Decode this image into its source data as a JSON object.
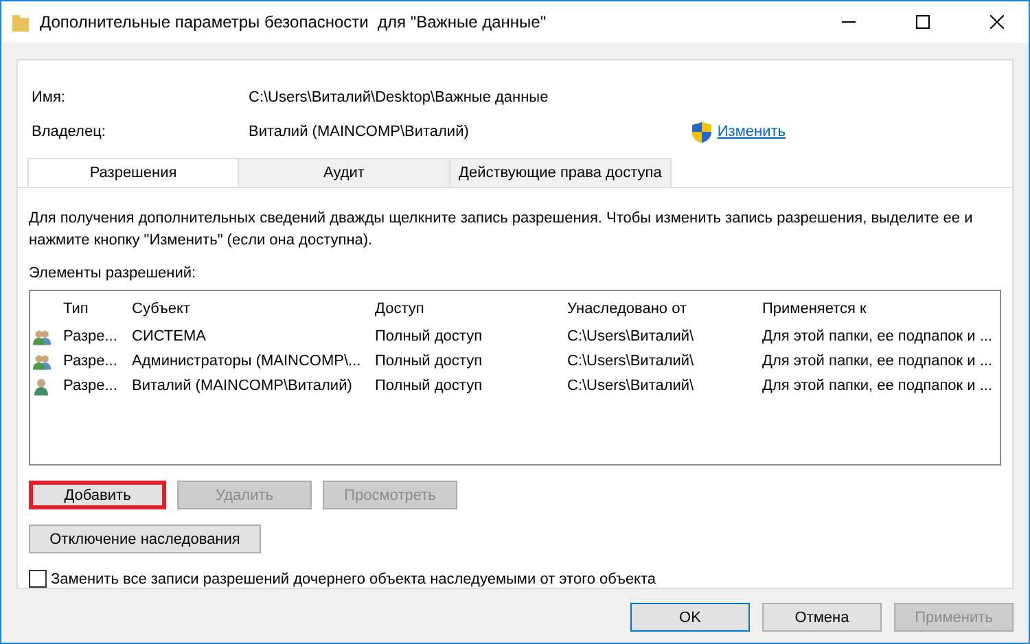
{
  "window": {
    "title": "Дополнительные параметры безопасности  для \"Важные данные\""
  },
  "name": {
    "label": "Имя:",
    "value": "C:\\Users\\Виталий\\Desktop\\Важные данные"
  },
  "owner": {
    "label": "Владелец:",
    "value": "Виталий (MAINCOMP\\Виталий)",
    "link": "Изменить"
  },
  "tabs": [
    {
      "label": "Разрешения",
      "selected": true
    },
    {
      "label": "Аудит",
      "selected": false
    },
    {
      "label": "Действующие права доступа",
      "selected": false
    }
  ],
  "description": "Для получения дополнительных сведений дважды щелкните запись разрешения. Чтобы изменить запись разрешения, выделите ее и нажмите кнопку \"Изменить\" (если она доступна).",
  "list_label": "Элементы разрешений:",
  "table": {
    "columns": [
      "Тип",
      "Субъект",
      "Доступ",
      "Унаследовано от",
      "Применяется к"
    ],
    "rows": [
      {
        "kind": "group",
        "cells": [
          "Разре...",
          "СИСТЕМА",
          "Полный доступ",
          "C:\\Users\\Виталий\\",
          "Для этой папки, ее подпапок и ..."
        ]
      },
      {
        "kind": "group",
        "cells": [
          "Разре...",
          "Администраторы (MAINCOMP\\...",
          "Полный доступ",
          "C:\\Users\\Виталий\\",
          "Для этой папки, ее подпапок и ..."
        ]
      },
      {
        "kind": "user",
        "cells": [
          "Разре...",
          "Виталий (MAINCOMP\\Виталий)",
          "Полный доступ",
          "C:\\Users\\Виталий\\",
          "Для этой папки, ее подпапок и ..."
        ]
      }
    ]
  },
  "entry_buttons": [
    {
      "label": "Добавить",
      "disabled": false,
      "highlighted": true
    },
    {
      "label": "Удалить",
      "disabled": true,
      "highlighted": false
    },
    {
      "label": "Просмотреть",
      "disabled": true,
      "highlighted": false
    }
  ],
  "inheritance_button": "Отключение наследования",
  "replace_checkbox": {
    "label": "Заменить все записи разрешений дочернего объекта наследуемыми от этого объекта",
    "checked": false
  },
  "footer_buttons": [
    {
      "label": "OK",
      "disabled": false,
      "default": true
    },
    {
      "label": "Отмена",
      "disabled": false,
      "default": false
    },
    {
      "label": "Применить",
      "disabled": true,
      "default": false
    }
  ]
}
